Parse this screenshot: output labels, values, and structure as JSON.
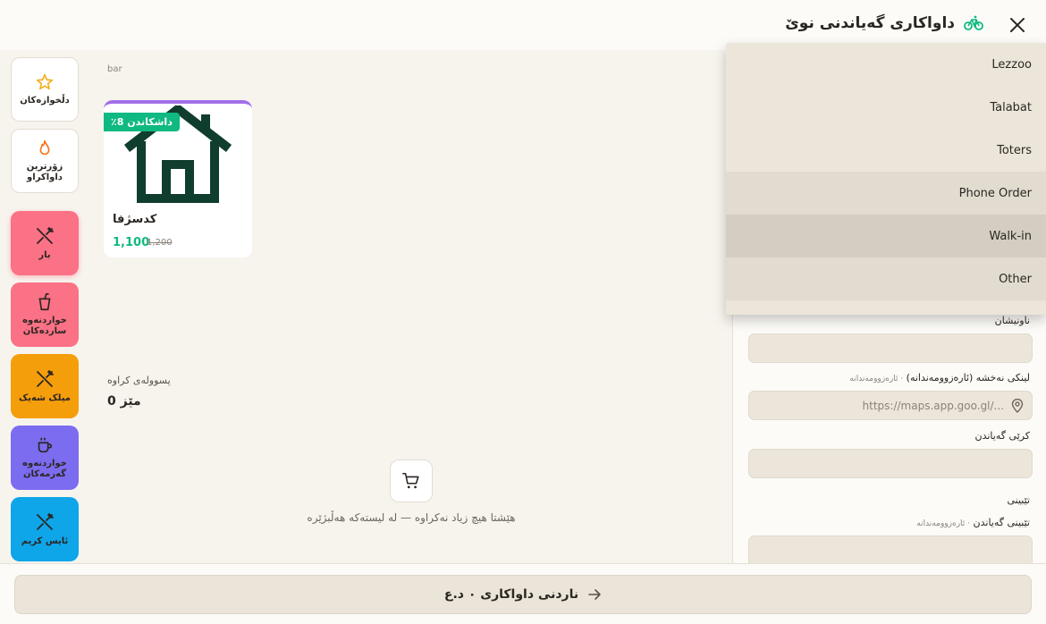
{
  "header": {
    "title": "داواکاری گەیاندنی نوێ",
    "close_label": "close"
  },
  "categories": [
    {
      "label": "دڵخوازەکان",
      "icon": "star-icon"
    },
    {
      "label": "زۆرترین داواکراو",
      "icon": "flame-icon"
    },
    {
      "label": "بار",
      "icon": "utensils-crossed-icon"
    },
    {
      "label": "خواردنەوە ساردەکان",
      "icon": "cup-straw-icon"
    },
    {
      "label": "میلک شەیک",
      "icon": "utensils-crossed-icon"
    },
    {
      "label": "خواردنەوە گەرمەکان",
      "icon": "coffee-cup-icon"
    },
    {
      "label": "ئایس کریم",
      "icon": "utensils-crossed-icon"
    }
  ],
  "main": {
    "section_label": "bar",
    "product": {
      "discount": "داشکاندن 8٪",
      "name": "کدسژفا",
      "price": "1,100",
      "old_price": "1,200",
      "image_icon": "house-icon"
    },
    "receipt_label": "پسوولەی کراوە",
    "table_value": "مێز 0",
    "empty_cart": "هێشتا هیچ زیاد نەکراوە — لە لیستەکە هەڵبژێرە"
  },
  "dropdown": {
    "options": [
      "Lezzoo",
      "Talabat",
      "Toters",
      "Phone Order",
      "Walk-in",
      "Other"
    ],
    "selected": "Walk-in"
  },
  "form": {
    "address_label": "ناونیشان",
    "map_label": "لینکی نەخشە (ئارەزوومەندانە)",
    "map_optional": "ئارەزوومەندانە",
    "map_placeholder": "https://maps.app.goo.gl/...",
    "fee_label": "کرێی گەیاندن",
    "notes_label": "تێبینی",
    "delivery_note_label": "تێبینی گەیاندن",
    "delivery_note_optional": "ئارەزوومەندانە"
  },
  "footer": {
    "submit_label": "ناردنی داواکاری ٠ د.ع"
  },
  "colors": {
    "accent_green": "#10b981",
    "pink": "#fb7185",
    "amber": "#f59e0b",
    "purple": "#7c6cf0",
    "sky": "#0ea5e9",
    "card_top": "#a26ee8"
  }
}
